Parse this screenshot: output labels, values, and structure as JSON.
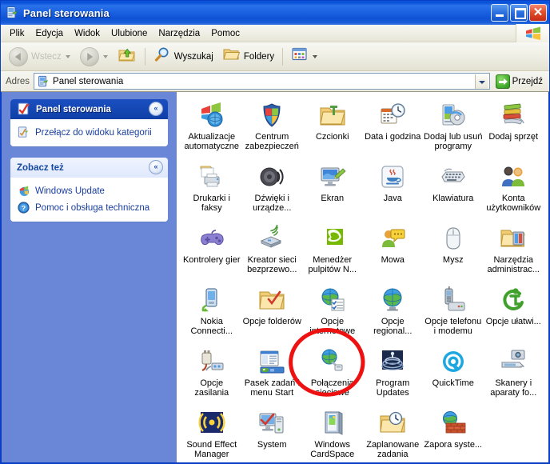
{
  "window": {
    "title": "Panel sterowania",
    "title_icon": "control-panel-icon",
    "minimize_label": "_",
    "maximize_label": "",
    "close_label": "✕"
  },
  "menubar": {
    "items": [
      {
        "label": "Plik"
      },
      {
        "label": "Edycja"
      },
      {
        "label": "Widok"
      },
      {
        "label": "Ulubione"
      },
      {
        "label": "Narzędzia"
      },
      {
        "label": "Pomoc"
      }
    ],
    "logo_icon": "windows-flag-icon"
  },
  "toolbar": {
    "back_label": "Wstecz",
    "back_icon": "arrow-left-icon",
    "forward_icon": "arrow-right-icon",
    "up_icon": "folder-up-icon",
    "search_label": "Wyszukaj",
    "search_icon": "magnifier-icon",
    "folders_label": "Foldery",
    "folders_icon": "folder-icon",
    "views_icon": "views-grid-icon"
  },
  "address": {
    "label": "Adres",
    "value": "Panel sterowania",
    "placeholder": "Panel sterowania",
    "icon": "control-panel-icon",
    "dropdown_icon": "chevron-down-icon",
    "go_label": "Przejdź",
    "go_icon": "green-arrow-icon"
  },
  "sidebar": {
    "panels": [
      {
        "title": "Panel sterowania",
        "style": "dark",
        "icon": "control-panel-icon",
        "chevron": "«",
        "links": [
          {
            "label": "Przełącz do widoku kategorii",
            "icon": "category-view-icon"
          }
        ]
      },
      {
        "title": "Zobacz też",
        "style": "light",
        "icon": "",
        "chevron": "«",
        "links": [
          {
            "label": "Windows Update",
            "icon": "windows-update-icon"
          },
          {
            "label": "Pomoc i obsługa techniczna",
            "icon": "help-icon"
          }
        ]
      }
    ]
  },
  "content": {
    "items": [
      {
        "label": "Aktualizacje automatyczne",
        "icon": "automatic-updates-icon"
      },
      {
        "label": "Centrum zabezpieczeń",
        "icon": "security-center-icon"
      },
      {
        "label": "Czcionki",
        "icon": "fonts-folder-icon"
      },
      {
        "label": "Data i godzina",
        "icon": "date-time-icon"
      },
      {
        "label": "Dodaj lub usuń programy",
        "icon": "add-remove-programs-icon"
      },
      {
        "label": "Dodaj sprzęt",
        "icon": "add-hardware-icon"
      },
      {
        "label": "Drukarki i faksy",
        "icon": "printers-faxes-icon"
      },
      {
        "label": "Dźwięki i urządze...",
        "icon": "sounds-audio-icon"
      },
      {
        "label": "Ekran",
        "icon": "display-icon"
      },
      {
        "label": "Java",
        "icon": "java-icon"
      },
      {
        "label": "Klawiatura",
        "icon": "keyboard-icon"
      },
      {
        "label": "Konta użytkowników",
        "icon": "user-accounts-icon"
      },
      {
        "label": "Kontrolery gier",
        "icon": "game-controllers-icon"
      },
      {
        "label": "Kreator sieci bezprzewo...",
        "icon": "wireless-network-wizard-icon"
      },
      {
        "label": "Menedżer pulpitów N...",
        "icon": "nvidia-desktop-manager-icon"
      },
      {
        "label": "Mowa",
        "icon": "speech-icon"
      },
      {
        "label": "Mysz",
        "icon": "mouse-icon"
      },
      {
        "label": "Narzędzia administrac...",
        "icon": "administrative-tools-icon"
      },
      {
        "label": "Nokia Connecti...",
        "icon": "nokia-connectivity-icon"
      },
      {
        "label": "Opcje folderów",
        "icon": "folder-options-icon"
      },
      {
        "label": "Opcje internetowe",
        "icon": "internet-options-icon"
      },
      {
        "label": "Opcje regional...",
        "icon": "regional-options-icon"
      },
      {
        "label": "Opcje telefonu i modemu",
        "icon": "phone-modem-options-icon"
      },
      {
        "label": "Opcje ułatwi...",
        "icon": "accessibility-options-icon"
      },
      {
        "label": "Opcje zasilania",
        "icon": "power-options-icon"
      },
      {
        "label": "Pasek zadań i menu Start",
        "icon": "taskbar-startmenu-icon"
      },
      {
        "label": "Połączenia sieciowe",
        "icon": "network-connections-icon"
      },
      {
        "label": "Program Updates",
        "icon": "program-updates-icon"
      },
      {
        "label": "QuickTime",
        "icon": "quicktime-icon"
      },
      {
        "label": "Skanery i aparaty fo...",
        "icon": "scanners-cameras-icon"
      },
      {
        "label": "Sound Effect Manager",
        "icon": "sound-effect-manager-icon"
      },
      {
        "label": "System",
        "icon": "system-icon"
      },
      {
        "label": "Windows CardSpace",
        "icon": "windows-cardspace-icon"
      },
      {
        "label": "Zaplanowane zadania",
        "icon": "scheduled-tasks-icon"
      },
      {
        "label": "Zapora syste...",
        "icon": "firewall-icon"
      }
    ],
    "annotation": {
      "shape": "ellipse",
      "target_label": "Połączenia sieciowe",
      "color": "#ee1111"
    }
  },
  "colors": {
    "titlebar_blue": "#0a50d8",
    "window_border": "#0a3fc4",
    "sidebar_blue": "#6a86d6",
    "panel_header_dark": "#1548b4",
    "link_blue": "#1a3e9e",
    "annotation_red": "#ee1111"
  }
}
